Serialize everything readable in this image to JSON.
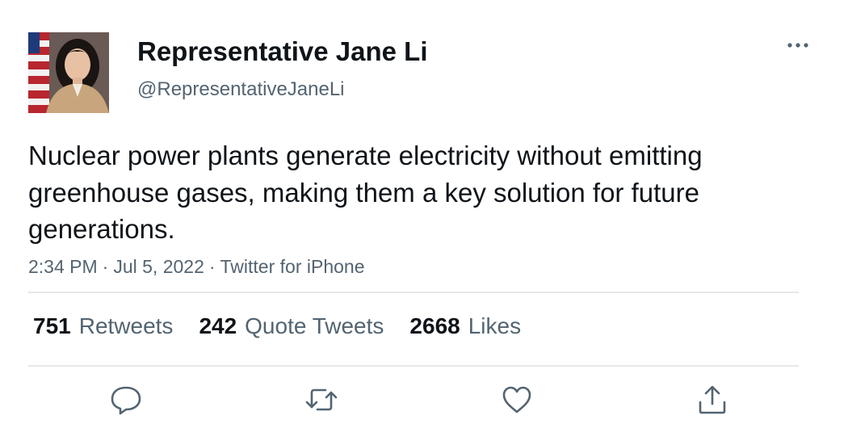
{
  "author": {
    "display_name": "Representative Jane Li",
    "handle": "@RepresentativeJaneLi",
    "avatar_icon": "profile-photo"
  },
  "tweet": {
    "text": "Nuclear power plants generate electricity without emitting greenhouse gases, making them a key solution for future generations.",
    "time": "2:34 PM",
    "date": "Jul 5, 2022",
    "source": "Twitter for iPhone",
    "separator": "·"
  },
  "stats": {
    "retweets": {
      "count": "751",
      "label": "Retweets"
    },
    "quote_tweets": {
      "count": "242",
      "label": "Quote Tweets"
    },
    "likes": {
      "count": "2668",
      "label": "Likes"
    }
  },
  "actions": {
    "reply_icon": "speech-bubble-icon",
    "retweet_icon": "retweet-arrows-icon",
    "like_icon": "heart-icon",
    "share_icon": "share-upload-icon",
    "more_icon": "ellipsis-icon"
  },
  "colors": {
    "text_primary": "#0f1419",
    "text_secondary": "#536471",
    "icon": "#536471",
    "divider": "#e4e8eb"
  }
}
